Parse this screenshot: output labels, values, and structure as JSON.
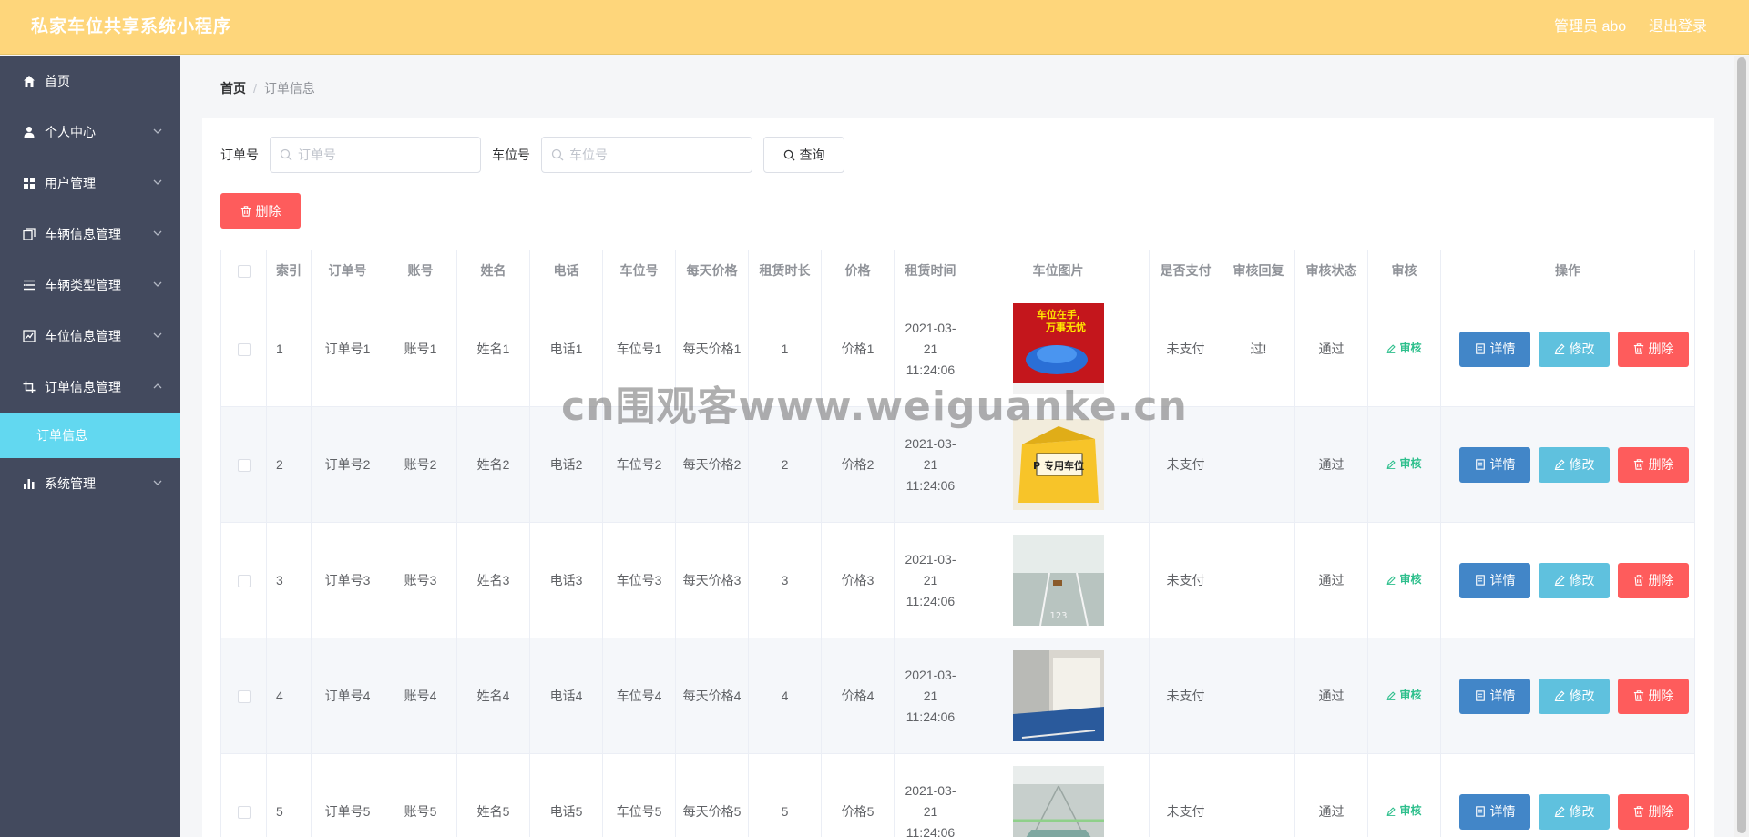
{
  "app": {
    "title": "私家车位共享系统小程序",
    "user_label": "管理员 abo",
    "logout_label": "退出登录"
  },
  "sidebar": {
    "items": [
      {
        "label": "首页",
        "icon": "home-icon",
        "expandable": false
      },
      {
        "label": "个人中心",
        "icon": "user-icon",
        "expandable": true
      },
      {
        "label": "用户管理",
        "icon": "grid-icon",
        "expandable": true
      },
      {
        "label": "车辆信息管理",
        "icon": "copy-icon",
        "expandable": true
      },
      {
        "label": "车辆类型管理",
        "icon": "list-icon",
        "expandable": true
      },
      {
        "label": "车位信息管理",
        "icon": "chart-icon",
        "expandable": true
      },
      {
        "label": "订单信息管理",
        "icon": "crop-icon",
        "expandable": true,
        "expanded": true
      },
      {
        "label": "订单信息",
        "sub": true,
        "active": true
      },
      {
        "label": "系统管理",
        "icon": "bar-icon",
        "expandable": true
      }
    ]
  },
  "breadcrumb": {
    "home": "首页",
    "separator": "/",
    "current": "订单信息"
  },
  "search": {
    "order_label": "订单号",
    "order_placeholder": "订单号",
    "space_label": "车位号",
    "space_placeholder": "车位号",
    "query_label": "查询"
  },
  "toolbar": {
    "delete_label": "删除"
  },
  "table": {
    "headers": [
      "索引",
      "订单号",
      "账号",
      "姓名",
      "电话",
      "车位号",
      "每天价格",
      "租赁时长",
      "价格",
      "租赁时间",
      "车位图片",
      "是否支付",
      "审核回复",
      "审核状态",
      "审核",
      "操作"
    ],
    "rows": [
      {
        "index": "1",
        "order": "订单号1",
        "account": "账号1",
        "name": "姓名1",
        "phone": "电话1",
        "space": "车位号1",
        "daily": "每天价格1",
        "duration": "1",
        "price": "价格1",
        "time": "2021-03-21 11:24:06",
        "paid": "未支付",
        "reply": "过!",
        "status": "通过",
        "audit": "审核"
      },
      {
        "index": "2",
        "order": "订单号2",
        "account": "账号2",
        "name": "姓名2",
        "phone": "电话2",
        "space": "车位号2",
        "daily": "每天价格2",
        "duration": "2",
        "price": "价格2",
        "time": "2021-03-21 11:24:06",
        "paid": "未支付",
        "reply": "",
        "status": "通过",
        "audit": "审核"
      },
      {
        "index": "3",
        "order": "订单号3",
        "account": "账号3",
        "name": "姓名3",
        "phone": "电话3",
        "space": "车位号3",
        "daily": "每天价格3",
        "duration": "3",
        "price": "价格3",
        "time": "2021-03-21 11:24:06",
        "paid": "未支付",
        "reply": "",
        "status": "通过",
        "audit": "审核"
      },
      {
        "index": "4",
        "order": "订单号4",
        "account": "账号4",
        "name": "姓名4",
        "phone": "电话4",
        "space": "车位号4",
        "daily": "每天价格4",
        "duration": "4",
        "price": "价格4",
        "time": "2021-03-21 11:24:06",
        "paid": "未支付",
        "reply": "",
        "status": "通过",
        "audit": "审核"
      },
      {
        "index": "5",
        "order": "订单号5",
        "account": "账号5",
        "name": "姓名5",
        "phone": "电话5",
        "space": "车位号5",
        "daily": "每天价格5",
        "duration": "5",
        "price": "价格5",
        "time": "2021-03-21 11:24:06",
        "paid": "未支付",
        "reply": "",
        "status": "通过",
        "audit": "审核"
      }
    ],
    "images": [
      {
        "text_top": "车位在手,",
        "text_bottom": "万事无忧"
      },
      {
        "text_top": "P 专用车位"
      },
      {
        "text_top": ""
      },
      {
        "text_top": ""
      },
      {
        "text_top": ""
      }
    ],
    "actions": {
      "detail": "详情",
      "edit": "修改",
      "remove": "删除"
    }
  },
  "watermark": "cn围观客www.weiguanke.cn",
  "colors": {
    "topbar": "#fed67b",
    "sidebar": "#434a5e",
    "active_sub": "#62d8f0",
    "danger": "#fe5c5c",
    "primary": "#4286c8",
    "info": "#5fc1de",
    "success": "#2dbf8c"
  }
}
